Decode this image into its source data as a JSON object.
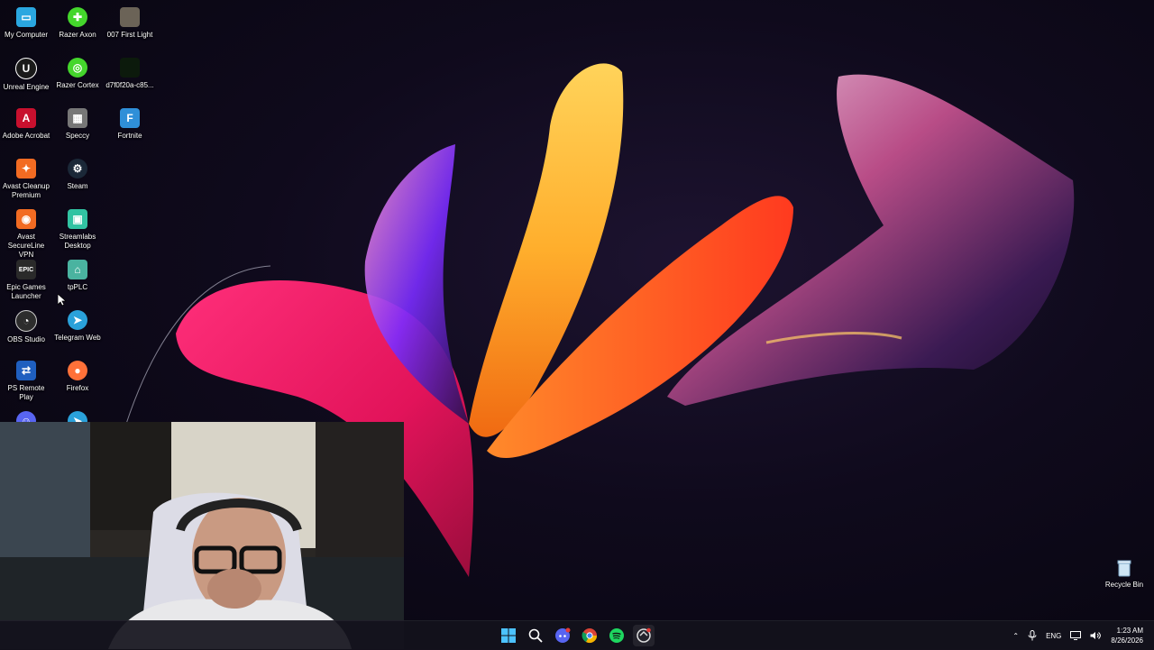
{
  "desktop": {
    "icons": [
      {
        "label": "My Computer",
        "icon": "monitor-icon",
        "color": "#2aa7e0"
      },
      {
        "label": "Razer Axon",
        "icon": "razer-axon-icon",
        "color": "#44d62c"
      },
      {
        "label": "007 First Light",
        "icon": "game-007-icon",
        "color": "#6b6357"
      },
      {
        "label": "Unreal Engine",
        "icon": "unreal-engine-icon",
        "color": "#1a1a1a"
      },
      {
        "label": "Razer Cortex",
        "icon": "razer-cortex-icon",
        "color": "#44d62c"
      },
      {
        "label": "d7f0f20a-c85...",
        "icon": "file-icon",
        "color": "#0c1a0c"
      },
      {
        "label": "Adobe Acrobat",
        "icon": "acrobat-icon",
        "color": "#c8102e"
      },
      {
        "label": "Speccy",
        "icon": "speccy-icon",
        "color": "#777777"
      },
      {
        "label": "Fortnite",
        "icon": "fortnite-icon",
        "color": "#2f8fd8"
      },
      {
        "label": "Avast Cleanup Premium",
        "icon": "avast-cleanup-icon",
        "color": "#f26b22"
      },
      {
        "label": "Steam",
        "icon": "steam-icon",
        "color": "#1b2838"
      },
      {
        "label": "Avast SecureLine VPN",
        "icon": "avast-vpn-icon",
        "color": "#f26b22"
      },
      {
        "label": "Streamlabs Desktop",
        "icon": "streamlabs-icon",
        "color": "#31c3a2"
      },
      {
        "label": "Epic Games Launcher",
        "icon": "epic-games-icon",
        "color": "#2a2a2a"
      },
      {
        "label": "tpPLC",
        "icon": "tpplc-icon",
        "color": "#4ab3a0"
      },
      {
        "label": "OBS Studio",
        "icon": "obs-icon",
        "color": "#2d2d2d"
      },
      {
        "label": "Telegram Web",
        "icon": "telegram-icon",
        "color": "#2aa1da"
      },
      {
        "label": "PS Remote Play",
        "icon": "ps-remote-play-icon",
        "color": "#1f5fbf"
      },
      {
        "label": "Firefox",
        "icon": "firefox-icon",
        "color": "#ff7139"
      },
      {
        "label": "",
        "icon": "discord-icon",
        "color": "#5865f2"
      },
      {
        "label": "",
        "icon": "telegram-icon",
        "color": "#2aa1da"
      }
    ],
    "recycle_bin": {
      "label": "Recycle Bin",
      "icon": "recycle-bin-icon"
    }
  },
  "taskbar": {
    "apps": [
      {
        "name": "start",
        "icon": "windows-start-icon"
      },
      {
        "name": "search",
        "icon": "search-icon"
      },
      {
        "name": "discord",
        "icon": "discord-icon"
      },
      {
        "name": "chrome",
        "icon": "chrome-icon"
      },
      {
        "name": "spotify",
        "icon": "spotify-icon"
      },
      {
        "name": "app",
        "icon": "app-icon"
      }
    ],
    "tray": {
      "language": "ENG",
      "time": "1:23 AM",
      "date": "8/26/2026"
    }
  }
}
